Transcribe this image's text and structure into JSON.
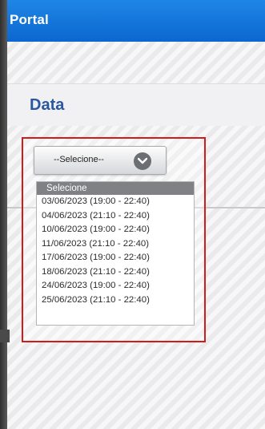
{
  "app": {
    "title": "Portal"
  },
  "section": {
    "title": "Data"
  },
  "select": {
    "current": "--Selecione--",
    "header_option": "Selecione",
    "options": [
      "03/06/2023 (19:00 - 22:40)",
      "04/06/2023 (21:10 - 22:40)",
      "10/06/2023 (19:00 - 22:40)",
      "11/06/2023 (21:10 - 22:40)",
      "17/06/2023 (19:00 - 22:40)",
      "18/06/2023 (21:10 - 22:40)",
      "24/06/2023 (19:00 - 22:40)",
      "25/06/2023 (21:10 - 22:40)"
    ]
  },
  "colors": {
    "topbar": "#0b67cf",
    "section_title": "#2a58a0",
    "highlight": "#d11b1b"
  }
}
